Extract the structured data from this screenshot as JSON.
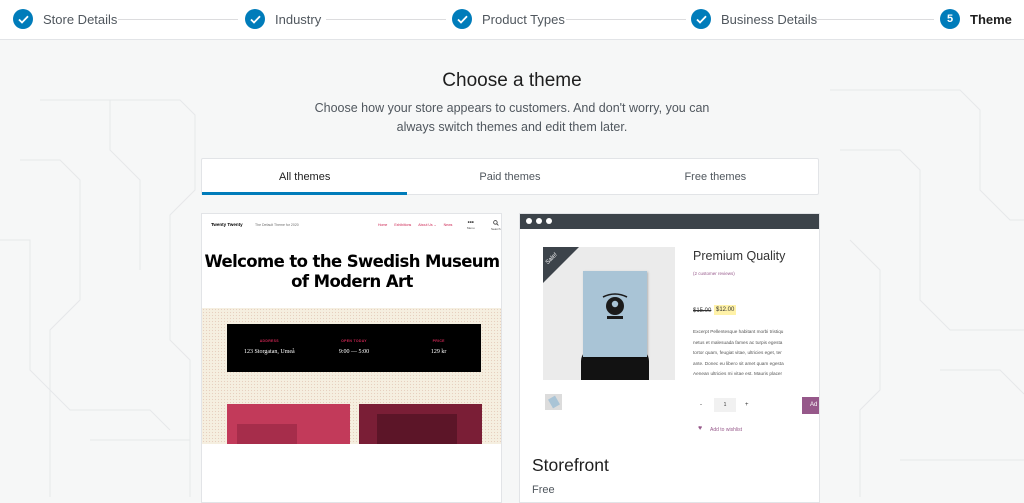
{
  "stepper": {
    "steps": [
      {
        "label": "Store Details",
        "state": "done"
      },
      {
        "label": "Industry",
        "state": "done"
      },
      {
        "label": "Product Types",
        "state": "done"
      },
      {
        "label": "Business Details",
        "state": "done"
      },
      {
        "label": "Theme",
        "number": "5",
        "state": "active"
      }
    ]
  },
  "page": {
    "title": "Choose a theme",
    "subtitle": "Choose how your store appears to customers. And don't worry, you can always switch themes and edit them later."
  },
  "tabs": [
    {
      "label": "All themes",
      "active": true
    },
    {
      "label": "Paid themes",
      "active": false
    },
    {
      "label": "Free themes",
      "active": false
    }
  ],
  "cards": {
    "twenty_twenty": {
      "preview": {
        "brand": "Twenty Twenty",
        "tagline": "The Default Theme for 2020",
        "menu": [
          "Home",
          "Exhibitions",
          "About Us ⌄",
          "News"
        ],
        "menu_button": "Menu",
        "search_button": "Search",
        "heading": "Welcome to the Swedish Museum of Modern Art",
        "info": [
          {
            "key": "ADDRESS",
            "value": "123 Storgatan, Umeå"
          },
          {
            "key": "OPEN TODAY",
            "value": "9:00 — 5:00"
          },
          {
            "key": "PRICE",
            "value": "129 kr"
          }
        ]
      }
    },
    "storefront": {
      "name": "Storefront",
      "price": "Free",
      "preview": {
        "sale_badge": "Sale!",
        "product_title": "Premium Quality",
        "reviews": "(2 customer reviews)",
        "old_price": "$15.00",
        "new_price": "$12.00",
        "excerpt_lines": [
          "Excerpt Pellentesque habitant morbi tristiqu",
          "netus et malesuada fames ac turpis egesta",
          "tortor quam, feugiat vitae, ultricies eget, ter",
          "ante. Donec eu libero sit amet quam egesta",
          "Aenean ultricies mi vitae est. Mauris placer"
        ],
        "qty_minus": "-",
        "qty_value": "1",
        "qty_plus": "+",
        "add_button": "Ad",
        "wishlist": "Add to wishlist"
      }
    }
  },
  "colors": {
    "accent": "#007cba",
    "woo_purple": "#96588a",
    "page_bg": "#f6f7f7"
  }
}
